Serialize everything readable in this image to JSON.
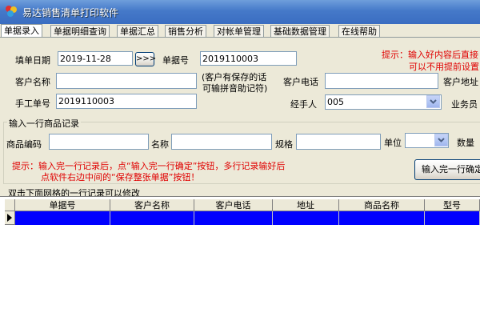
{
  "window": {
    "title": "易达销售清单打印软件"
  },
  "tabs": [
    {
      "label": "单据录入"
    },
    {
      "label": "单据明细查询"
    },
    {
      "label": "单据汇总"
    },
    {
      "label": "销售分析"
    },
    {
      "label": "对帐单管理"
    },
    {
      "label": "基础数据管理"
    },
    {
      "label": "在线帮助"
    }
  ],
  "form": {
    "date_label": "填单日期",
    "date_value": "2019-11-28",
    "date_button": ">>>",
    "order_no_label": "单据号",
    "order_no_value": "2019110003",
    "hint_top_line1": "提示：输入好内容后直接",
    "hint_top_line2": "可以不用提前设置",
    "customer_name_label": "客户名称",
    "customer_name_value": "",
    "customer_note_line1": "(客户有保存的话",
    "customer_note_line2": "可输拼音助记符)",
    "customer_phone_label": "客户电话",
    "customer_phone_value": "",
    "customer_address_label": "客户地址",
    "manual_no_label": "手工单号",
    "manual_no_value": "2019110003",
    "handler_label": "经手人",
    "handler_value": "005",
    "salesman_label": "业务员"
  },
  "item_group": {
    "title": "输入一行商品记录",
    "code_label": "商品编码",
    "code_value": "",
    "name_label": "名称",
    "name_value": "",
    "spec_label": "规格",
    "spec_value": "",
    "unit_label": "单位",
    "unit_value": "",
    "qty_label": "数量",
    "hint_line1": "提示：输入完一行记录后，点“输入完一行确定”按钮，多行记录输好后",
    "hint_line2": "点软件右边中间的“保存整张单据”按钮！",
    "confirm_button": "输入完一行确定"
  },
  "grid": {
    "caption": "双击下面网格的一行记录可以修改",
    "columns": [
      "单据号",
      "客户名称",
      "客户电话",
      "地址",
      "商品名称",
      "型号"
    ]
  }
}
